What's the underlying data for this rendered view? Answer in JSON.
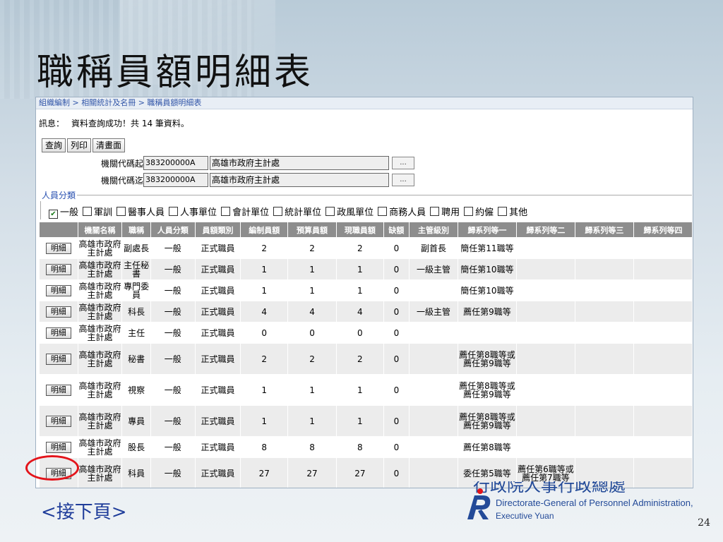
{
  "slide": {
    "title": "職稱員額明細表",
    "next_label": "<接下頁>",
    "page_number": "24"
  },
  "app": {
    "breadcrumb": "組織編制 > 相關統計及名冊 > 職稱員額明細表",
    "message_label": "訊息：",
    "message_text": "資料查詢成功！共 14 筆資料。",
    "buttons": {
      "query": "查詢",
      "print": "列印",
      "clear": "清畫面"
    },
    "org_from": {
      "label": "機關代碼起",
      "code": "383200000A",
      "name": "高雄市政府主計處",
      "lookup": "..."
    },
    "org_to": {
      "label": "機關代碼迄",
      "code": "383200000A",
      "name": "高雄市政府主計處",
      "lookup": "..."
    },
    "category_legend": "人員分類",
    "categories": [
      {
        "label": "一般",
        "checked": true
      },
      {
        "label": "軍訓",
        "checked": false
      },
      {
        "label": "醫事人員",
        "checked": false
      },
      {
        "label": "人事單位",
        "checked": false
      },
      {
        "label": "會計單位",
        "checked": false
      },
      {
        "label": "統計單位",
        "checked": false
      },
      {
        "label": "政風單位",
        "checked": false
      },
      {
        "label": "商務人員",
        "checked": false
      },
      {
        "label": "聘用",
        "checked": false
      },
      {
        "label": "約僱",
        "checked": false
      },
      {
        "label": "其他",
        "checked": false
      }
    ],
    "table": {
      "detail_label": "明細",
      "headers": [
        "",
        "機關名稱",
        "職稱",
        "人員分類",
        "員額類別",
        "編制員額",
        "預算員額",
        "現職員額",
        "缺額",
        "主管級別",
        "歸系列等一",
        "歸系列等二",
        "歸系列等三",
        "歸系列等四"
      ],
      "rows": [
        [
          "",
          "高雄市政府主計處",
          "副處長",
          "一般",
          "正式職員",
          "2",
          "2",
          "2",
          "0",
          "副首長",
          "簡任第11職等",
          "",
          "",
          ""
        ],
        [
          "",
          "高雄市政府主計處",
          "主任秘書",
          "一般",
          "正式職員",
          "1",
          "1",
          "1",
          "0",
          "一級主管",
          "簡任第10職等",
          "",
          "",
          ""
        ],
        [
          "",
          "高雄市政府主計處",
          "專門委員",
          "一般",
          "正式職員",
          "1",
          "1",
          "1",
          "0",
          "",
          "簡任第10職等",
          "",
          "",
          ""
        ],
        [
          "",
          "高雄市政府主計處",
          "科長",
          "一般",
          "正式職員",
          "4",
          "4",
          "4",
          "0",
          "一級主管",
          "薦任第9職等",
          "",
          "",
          ""
        ],
        [
          "",
          "高雄市政府主計處",
          "主任",
          "一般",
          "正式職員",
          "0",
          "0",
          "0",
          "0",
          "",
          "",
          "",
          "",
          ""
        ],
        [
          "",
          "高雄市政府主計處",
          "秘書",
          "一般",
          "正式職員",
          "2",
          "2",
          "2",
          "0",
          "",
          "薦任第8職等或薦任第9職等",
          "",
          "",
          ""
        ],
        [
          "",
          "高雄市政府主計處",
          "視察",
          "一般",
          "正式職員",
          "1",
          "1",
          "1",
          "0",
          "",
          "薦任第8職等或薦任第9職等",
          "",
          "",
          ""
        ],
        [
          "",
          "高雄市政府主計處",
          "專員",
          "一般",
          "正式職員",
          "1",
          "1",
          "1",
          "0",
          "",
          "薦任第8職等或薦任第9職等",
          "",
          "",
          ""
        ],
        [
          "",
          "高雄市政府主計處",
          "股長",
          "一般",
          "正式職員",
          "8",
          "8",
          "8",
          "0",
          "",
          "薦任第8職等",
          "",
          "",
          ""
        ],
        [
          "",
          "高雄市政府主計處",
          "科員",
          "一般",
          "正式職員",
          "27",
          "27",
          "27",
          "0",
          "",
          "委任第5職等",
          "薦任第6職等或薦任第7職等",
          "",
          ""
        ]
      ]
    }
  },
  "logo": {
    "chinese": "行政院人事行政總處",
    "english_line1": "Directorate-General of Personnel Administration,",
    "english_line2": "Executive Yuan",
    "color": "#234a98"
  },
  "colors": {
    "highlight_circle": "#e3141b",
    "header_bg": "#8d8d8d",
    "link_blue": "#3155a8"
  }
}
